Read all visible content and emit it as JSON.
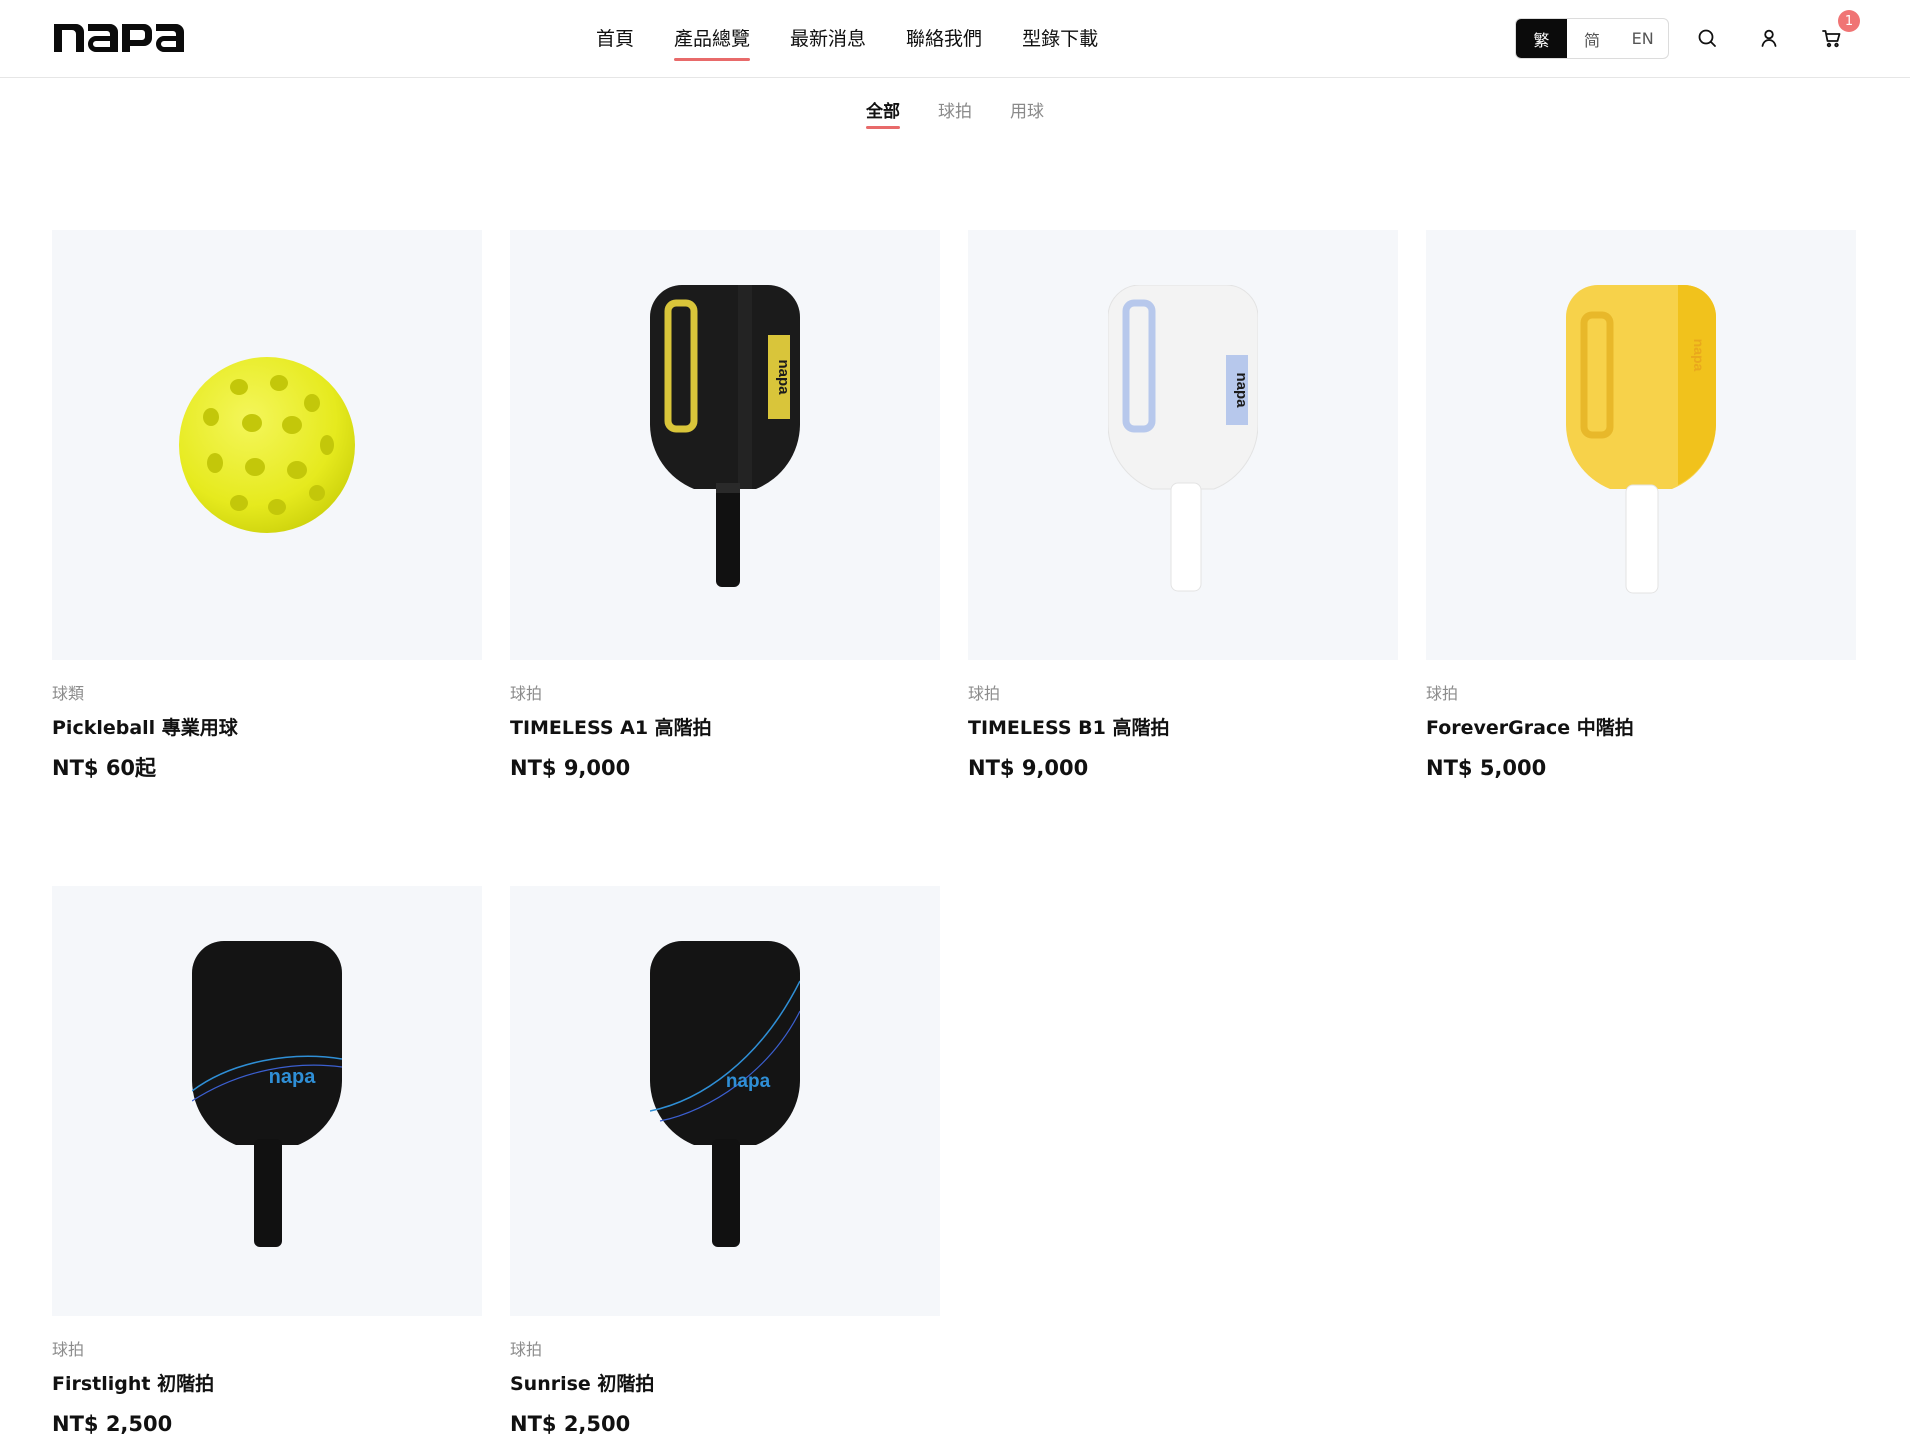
{
  "brand": {
    "logo_text": "napa"
  },
  "nav": {
    "items": [
      {
        "label": "首頁",
        "active": false
      },
      {
        "label": "產品總覽",
        "active": true
      },
      {
        "label": "最新消息",
        "active": false
      },
      {
        "label": "聯絡我們",
        "active": false
      },
      {
        "label": "型錄下載",
        "active": false
      }
    ]
  },
  "language": {
    "options": [
      "繁",
      "简",
      "EN"
    ],
    "selected": "繁"
  },
  "header_icons": {
    "search": "search-icon",
    "account": "user-icon",
    "cart": "cart-icon",
    "cart_count": "1"
  },
  "filters": {
    "tabs": [
      "全部",
      "球拍",
      "用球"
    ],
    "active": "全部"
  },
  "colors": {
    "accent": "#e86a6a",
    "badge": "#f07474",
    "image_bg": "#f5f7fa",
    "ball": "#e8ec2a",
    "paddle_a1": "#1b1b1b",
    "paddle_a1_accent": "#d9c53a",
    "paddle_b1": "#f3f3f3",
    "paddle_b1_accent": "#b7c8ec",
    "paddle_fg": "#f7d24a",
    "paddle_fg_accent": "#e8b82a",
    "paddle_blue_accent": "#2f8fd6"
  },
  "products": [
    {
      "category": "球類",
      "name": "Pickleball 專業用球",
      "price": "NT$ 60起",
      "image": "pickleball-ball-image"
    },
    {
      "category": "球拍",
      "name": "TIMELESS A1 高階拍",
      "price": "NT$ 9,000",
      "image": "black-yellow-paddle-image"
    },
    {
      "category": "球拍",
      "name": "TIMELESS B1 高階拍",
      "price": "NT$ 9,000",
      "image": "white-blue-paddle-image"
    },
    {
      "category": "球拍",
      "name": "ForeverGrace 中階拍",
      "price": "NT$ 5,000",
      "image": "yellow-paddle-image"
    },
    {
      "category": "球拍",
      "name": "Firstlight 初階拍",
      "price": "NT$ 2,500",
      "image": "black-blue-paddle-image"
    },
    {
      "category": "球拍",
      "name": "Sunrise 初階拍",
      "price": "NT$ 2,500",
      "image": "black-blue-wave-paddle-image"
    }
  ]
}
